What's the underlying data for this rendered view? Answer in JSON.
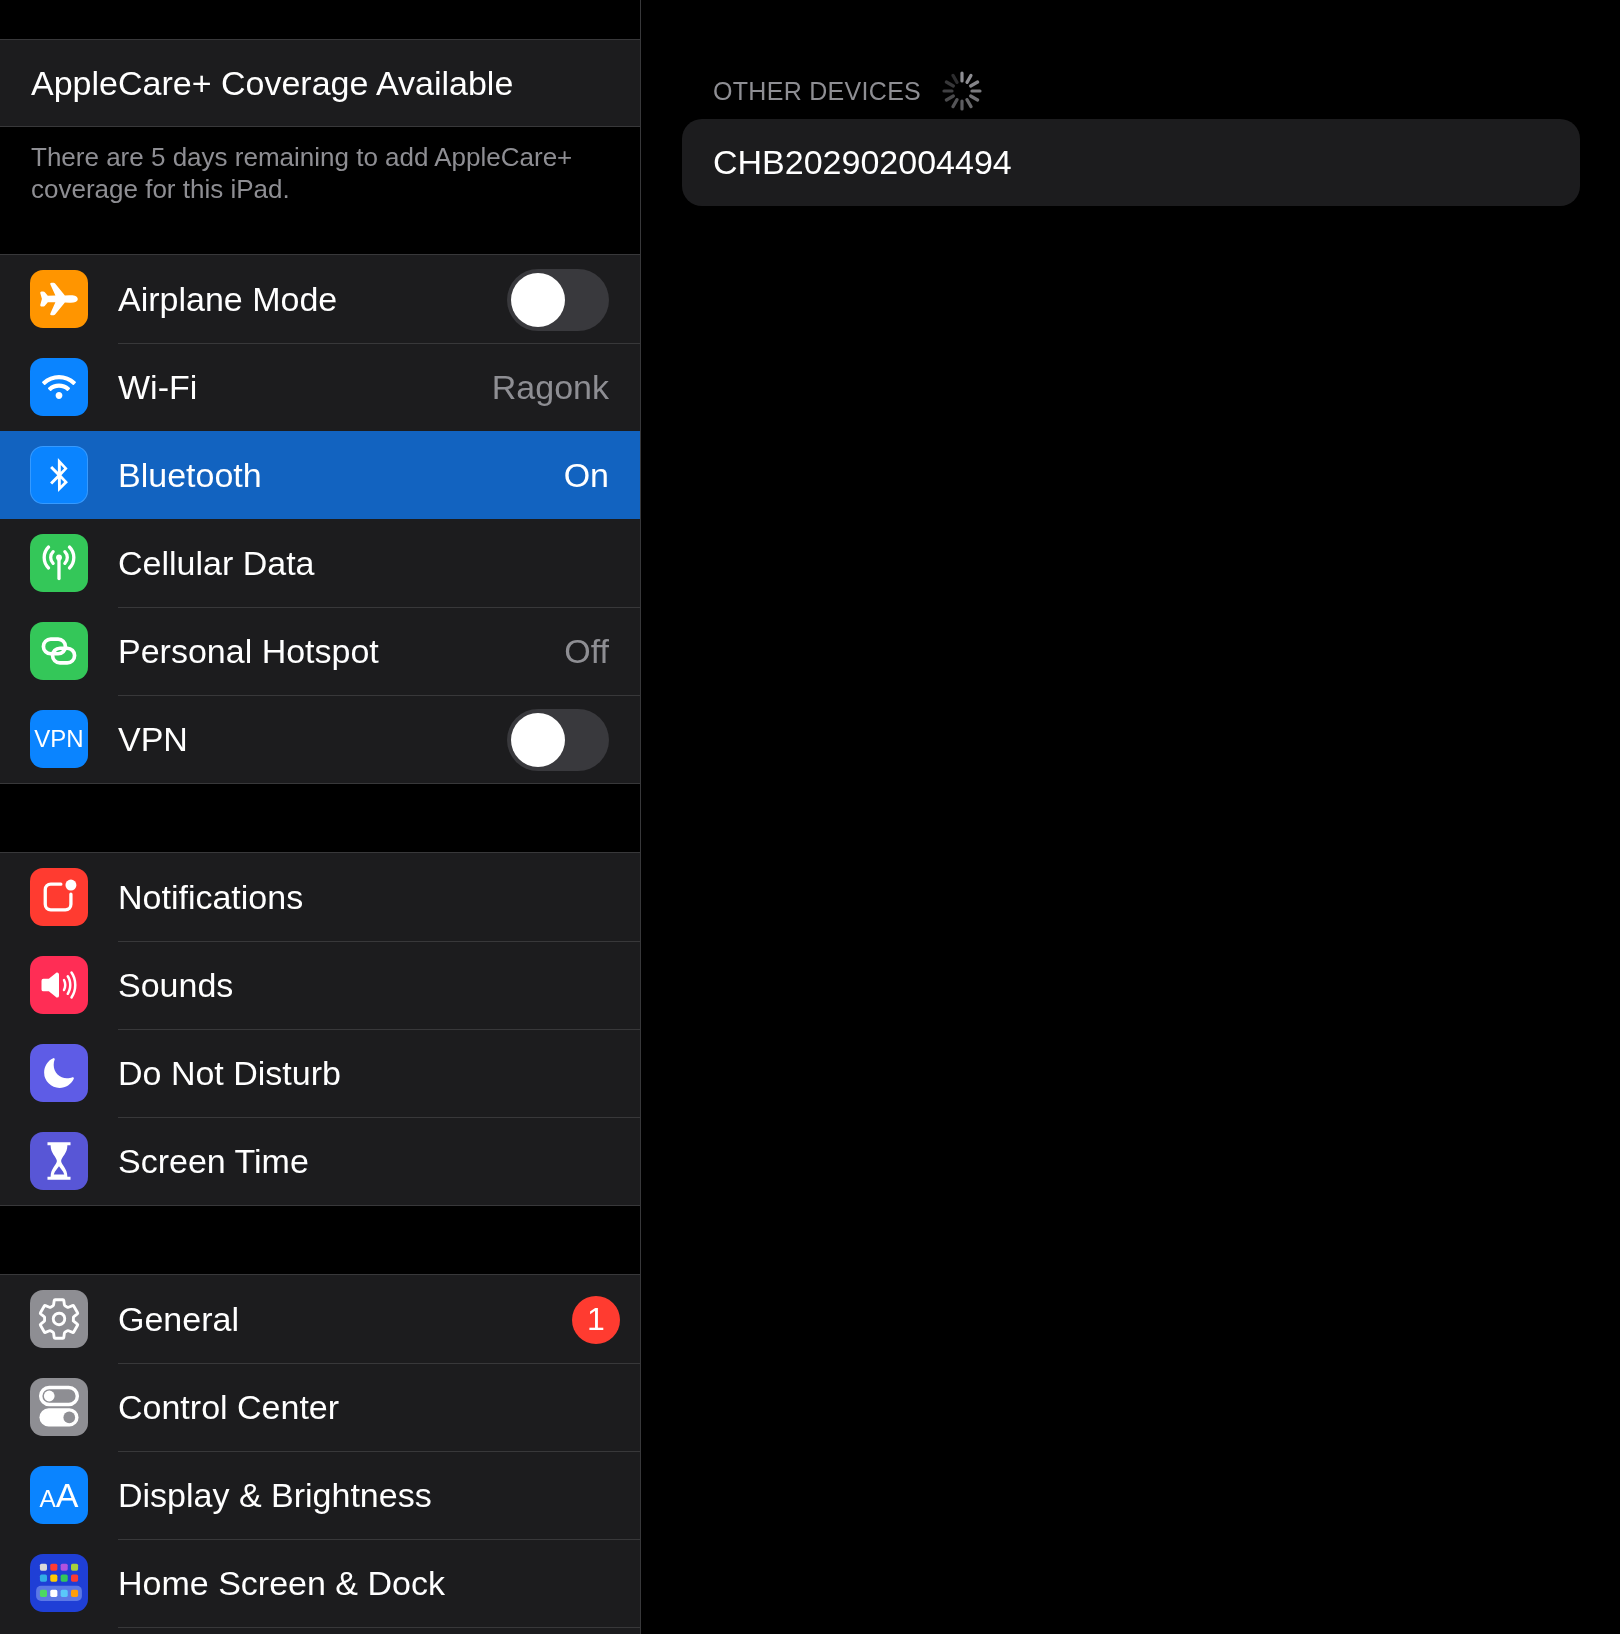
{
  "applecare": {
    "title": "AppleCare+ Coverage Available",
    "description": "There are 5 days remaining to add AppleCare+ coverage for this iPad."
  },
  "sidebar": {
    "groups": [
      {
        "items": [
          {
            "label": "Airplane Mode",
            "kind": "toggle",
            "on": false,
            "selected": false
          },
          {
            "label": "Wi-Fi",
            "kind": "value",
            "value": "Ragonk",
            "selected": false
          },
          {
            "label": "Bluetooth",
            "kind": "value",
            "value": "On",
            "selected": true
          },
          {
            "label": "Cellular Data",
            "kind": "plain",
            "selected": false
          },
          {
            "label": "Personal Hotspot",
            "kind": "value",
            "value": "Off",
            "selected": false
          },
          {
            "label": "VPN",
            "icon_text": "VPN",
            "kind": "toggle",
            "on": false,
            "selected": false
          }
        ]
      },
      {
        "items": [
          {
            "label": "Notifications",
            "kind": "plain",
            "selected": false
          },
          {
            "label": "Sounds",
            "kind": "plain",
            "selected": false
          },
          {
            "label": "Do Not Disturb",
            "kind": "plain",
            "selected": false
          },
          {
            "label": "Screen Time",
            "kind": "plain",
            "selected": false
          }
        ]
      },
      {
        "items": [
          {
            "label": "General",
            "kind": "badge",
            "badge": "1",
            "selected": false
          },
          {
            "label": "Control Center",
            "kind": "plain",
            "selected": false
          },
          {
            "label": "Display & Brightness",
            "icon_text": "AA",
            "kind": "plain",
            "selected": false
          },
          {
            "label": "Home Screen & Dock",
            "kind": "plain",
            "selected": false
          }
        ]
      }
    ]
  },
  "other_devices": {
    "heading": "OTHER DEVICES",
    "loading": true,
    "devices": [
      {
        "name": "CHB202902004494"
      }
    ]
  }
}
